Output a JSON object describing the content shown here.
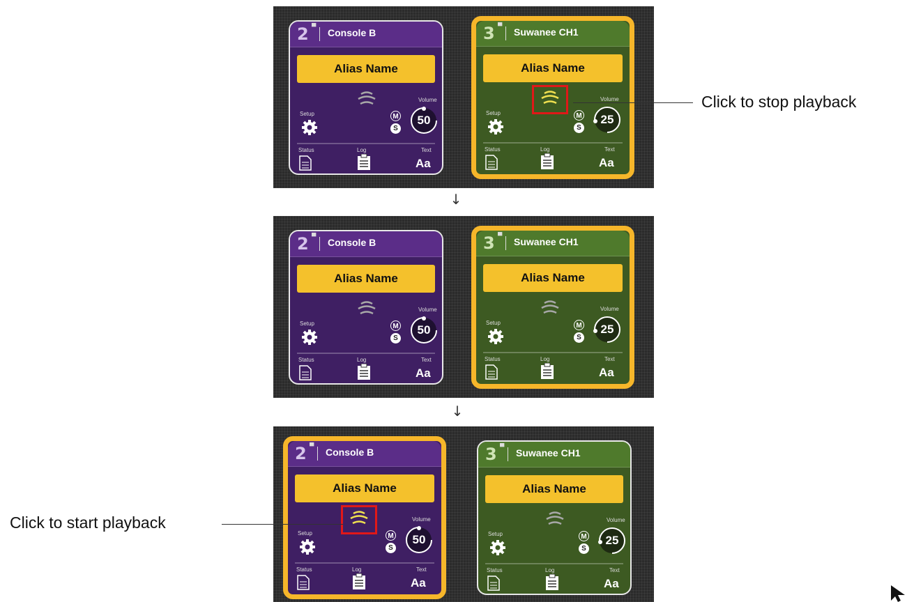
{
  "panels": [
    {
      "cards": [
        {
          "number": "2",
          "name": "Console B",
          "alias": "Alias Name",
          "color": "#3f1f63",
          "header_color": "#5b2d88",
          "active": false,
          "playing": false,
          "volume": "50"
        },
        {
          "number": "3",
          "name": "Suwanee CH1",
          "alias": "Alias Name",
          "color": "#3d5a22",
          "header_color": "#4f7a2c",
          "active": true,
          "playing": true,
          "volume": "25"
        }
      ]
    },
    {
      "cards": [
        {
          "number": "2",
          "name": "Console B",
          "alias": "Alias Name",
          "color": "#3f1f63",
          "header_color": "#5b2d88",
          "active": false,
          "playing": false,
          "volume": "50"
        },
        {
          "number": "3",
          "name": "Suwanee CH1",
          "alias": "Alias Name",
          "color": "#3d5a22",
          "header_color": "#4f7a2c",
          "active": true,
          "playing": false,
          "volume": "25"
        }
      ]
    },
    {
      "cards": [
        {
          "number": "2",
          "name": "Console B",
          "alias": "Alias Name",
          "color": "#3f1f63",
          "header_color": "#5b2d88",
          "active": true,
          "playing": true,
          "volume": "50"
        },
        {
          "number": "3",
          "name": "Suwanee CH1",
          "alias": "Alias Name",
          "color": "#3d5a22",
          "header_color": "#4f7a2c",
          "active": false,
          "playing": false,
          "volume": "25"
        }
      ]
    }
  ],
  "labels": {
    "setup": "Setup",
    "volume": "Volume",
    "status": "Status",
    "log": "Log",
    "text": "Text",
    "text_icon": "Aa",
    "mute": "M",
    "solo": "S"
  },
  "arrows": [
    "↓",
    "↓"
  ],
  "callouts": {
    "stop": "Click to stop playback",
    "start": "Click to start playback"
  },
  "colors": {
    "accent_border": "#f6b62a",
    "alias_bg": "#f4c12c",
    "highlight_box": "#e01818",
    "wave_active": "#f0e050",
    "wave_inactive": "#a8a8a8"
  },
  "icons": [
    "gear-icon",
    "wave-icon",
    "document-icon",
    "clipboard-icon",
    "mute-icon",
    "solo-icon",
    "volume-knob-icon",
    "cursor-icon"
  ]
}
